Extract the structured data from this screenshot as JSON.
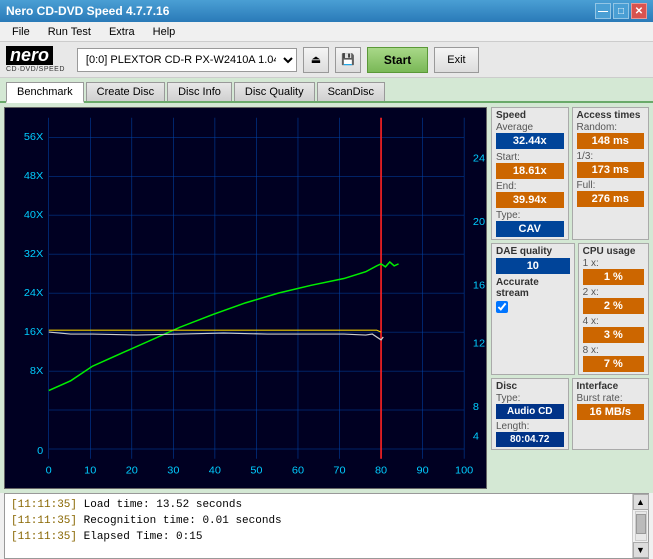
{
  "titleBar": {
    "title": "Nero CD-DVD Speed 4.7.7.16",
    "minimizeBtn": "—",
    "maximizeBtn": "□",
    "closeBtn": "✕"
  },
  "menuBar": {
    "items": [
      "File",
      "Run Test",
      "Extra",
      "Help"
    ]
  },
  "toolbar": {
    "logoText": "nero",
    "logoSubText": "CD·DVD/SPEED",
    "driveLabel": "[0:0]  PLEXTOR CD-R  PX-W2410A 1.04",
    "startLabel": "Start",
    "exitLabel": "Exit"
  },
  "tabs": {
    "items": [
      "Benchmark",
      "Create Disc",
      "Disc Info",
      "Disc Quality",
      "ScanDisc"
    ],
    "activeIndex": 0
  },
  "sidePanel": {
    "speed": {
      "label": "Speed",
      "average": {
        "label": "Average",
        "value": "32.44x"
      },
      "start": {
        "label": "Start:",
        "value": "18.61x"
      },
      "end": {
        "label": "End:",
        "value": "39.94x"
      },
      "type": {
        "label": "Type:",
        "value": "CAV"
      }
    },
    "accessTimes": {
      "label": "Access times",
      "random": {
        "label": "Random:",
        "value": "148 ms"
      },
      "oneThird": {
        "label": "1/3:",
        "value": "173 ms"
      },
      "full": {
        "label": "Full:",
        "value": "276 ms"
      }
    },
    "daeQuality": {
      "label": "DAE quality",
      "value": "10"
    },
    "accurateStream": {
      "label": "Accurate stream",
      "checked": true
    },
    "cpuUsage": {
      "label": "CPU usage",
      "x1": {
        "label": "1 x:",
        "value": "1 %"
      },
      "x2": {
        "label": "2 x:",
        "value": "2 %"
      },
      "x4": {
        "label": "4 x:",
        "value": "3 %"
      },
      "x8": {
        "label": "8 x:",
        "value": "7 %"
      }
    },
    "disc": {
      "label": "Disc",
      "type": {
        "label": "Type:",
        "value": "Audio CD"
      },
      "length": {
        "label": "Length:",
        "value": "80:04.72"
      }
    },
    "interface": {
      "label": "Interface",
      "burstRate": {
        "label": "Burst rate:",
        "value": "16 MB/s"
      }
    }
  },
  "chart": {
    "yAxisLeft": [
      "56X",
      "48X",
      "40X",
      "32X",
      "24X",
      "16X",
      "8X",
      "0"
    ],
    "yAxisRight": [
      "24",
      "20",
      "16",
      "12",
      "8",
      "4"
    ],
    "xAxis": [
      "0",
      "10",
      "20",
      "30",
      "40",
      "50",
      "60",
      "70",
      "80",
      "90",
      "100"
    ]
  },
  "log": {
    "lines": [
      {
        "time": "[11:11:35]",
        "text": "Load time: 13.52 seconds"
      },
      {
        "time": "[11:11:35]",
        "text": "Recognition time: 0.01 seconds"
      },
      {
        "time": "[11:11:35]",
        "text": "Elapsed Time: 0:15"
      }
    ]
  }
}
